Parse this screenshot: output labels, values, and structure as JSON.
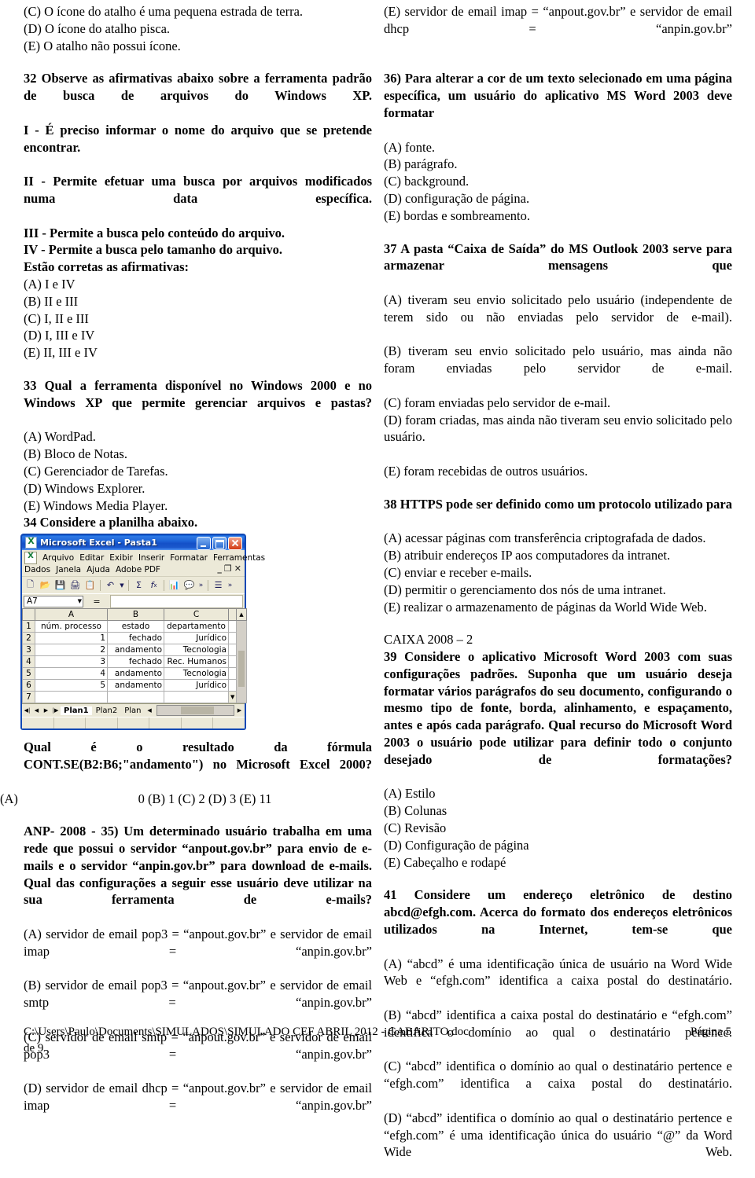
{
  "document": {
    "footer_path": "C:\\Users\\Paulo\\Documents\\SIMULADOS\\SIMULADO CEF ABRIL 2012 - GABARITO.doc",
    "footer_page": "Página 5",
    "footer_page_cont": "de 9"
  },
  "left_column": {
    "q31_tail_options": [
      "(C) O ícone do atalho é uma pequena estrada de terra.",
      "(D) O ícone do atalho pisca.",
      "(E) O atalho não possui ícone."
    ],
    "q32": {
      "stem": "32 Observe as afirmativas abaixo sobre a ferramenta padrão de busca de arquivos do Windows XP.",
      "statements": [
        "I - É preciso informar o nome do arquivo que se pretende encontrar.",
        "II - Permite efetuar uma busca por arquivos modificados numa data específica.",
        "III - Permite a busca pelo conteúdo do arquivo.",
        "IV - Permite a busca pelo tamanho do arquivo.",
        "Estão corretas as afirmativas:"
      ],
      "options": [
        "(A) I e IV",
        "(B) II e III",
        "(C) I, II e III",
        "(D) I, III e IV",
        "(E) II, III e IV"
      ]
    },
    "q33": {
      "stem": "33 Qual a ferramenta disponível no Windows 2000 e no Windows XP que permite gerenciar arquivos e pastas?",
      "options": [
        "(A) WordPad.",
        "(B) Bloco de Notas.",
        "(C) Gerenciador de Tarefas.",
        "(D) Windows Explorer.",
        "(E) Windows Media Player."
      ]
    },
    "q34": {
      "stem": "34 Considere a planilha abaixo.",
      "question": "Qual é o resultado da fórmula CONT.SE(B2:B6;\"andamento\") no Microsoft Excel 2000?",
      "answer_label": "(A)",
      "answer_options": "0 (B) 1 (C) 2 (D) 3 (E) 11"
    },
    "q35": {
      "stem": "ANP- 2008 - 35) Um determinado usuário trabalha em uma rede que possui o servidor “anpout.gov.br” para envio de e-mails e o servidor “anpin.gov.br” para download de e-mails. Qual das configurações a seguir esse usuário deve utilizar na sua ferramenta de e-mails?",
      "options": [
        "(A) servidor de email pop3 = “anpout.gov.br” e servidor de email imap = “anpin.gov.br”",
        "(B) servidor de email pop3 = “anpout.gov.br” e servidor de email smtp = “anpin.gov.br”",
        "(C) servidor de email smtp = “anpout.gov.br” e servidor de email pop3 = “anpin.gov.br”",
        "(D) servidor de email dhcp = “anpout.gov.br” e servidor de email imap = “anpin.gov.br”"
      ]
    }
  },
  "right_column": {
    "q35_tail": "(E) servidor de email imap = “anpout.gov.br” e servidor de email dhcp = “anpin.gov.br”",
    "q36": {
      "stem": "36) Para alterar a cor de um texto selecionado em uma página específica, um usuário do aplicativo MS Word 2003 deve formatar",
      "options": [
        "(A) fonte.",
        "(B) parágrafo.",
        "(C) background.",
        "(D) configuração de página.",
        "(E) bordas e sombreamento."
      ]
    },
    "q37": {
      "stem": "37 A pasta “Caixa de Saída” do MS Outlook 2003 serve para armazenar mensagens que",
      "options": [
        "(A) tiveram seu envio solicitado pelo usuário (independente de terem sido ou não enviadas pelo servidor de e-mail).",
        "(B) tiveram seu envio solicitado pelo usuário, mas ainda não foram enviadas pelo servidor de e-mail.",
        "(C) foram enviadas pelo servidor de e-mail.",
        "(D) foram criadas, mas ainda não tiveram seu envio solicitado pelo usuário.",
        "(E) foram recebidas de outros usuários."
      ]
    },
    "q38": {
      "stem": "38 HTTPS pode ser definido como um protocolo utilizado para",
      "options": [
        "(A) acessar páginas com transferência criptografada de dados.",
        "(B) atribuir endereços IP aos computadores da intranet.",
        "(C) enviar e receber e-mails.",
        "(D) permitir o gerenciamento dos nós de uma intranet.",
        "(E) realizar o armazenamento de páginas da World Wide Web."
      ]
    },
    "section_label": "CAIXA 2008 – 2",
    "q39": {
      "stem": "39 Considere o aplicativo Microsoft Word 2003 com suas configurações padrões. Suponha que um usuário deseja formatar vários parágrafos do seu documento, configurando o mesmo tipo de fonte, borda, alinhamento, e espaçamento, antes e após cada parágrafo. Qual recurso do Microsoft Word 2003 o usuário pode utilizar para definir todo o conjunto desejado de formatações?",
      "options": [
        "(A) Estilo",
        "(B) Colunas",
        "(C) Revisão",
        "(D) Configuração de página",
        "(E) Cabeçalho e rodapé"
      ]
    },
    "q41": {
      "stem": "41 Considere um endereço eletrônico de destino abcd@efgh.com. Acerca do formato dos endereços eletrônicos utilizados na Internet, tem-se que",
      "options": [
        "(A) “abcd” é uma identificação única de usuário na Word Wide Web e “efgh.com” identifica a caixa postal do destinatário.",
        "(B) “abcd” identifica a caixa postal do destinatário e “efgh.com” identifica o domínio ao qual o destinatário pertence.",
        "(C) “abcd” identifica o domínio ao qual o destinatário pertence e “efgh.com” identifica a caixa postal do destinatário.",
        "(D) “abcd” identifica o domínio ao qual o destinatário pertence e “efgh.com” é uma identificação única do usuário “@” da Word Wide Web."
      ]
    }
  },
  "excel_window": {
    "title": "Microsoft Excel - Pasta1",
    "window_buttons": [
      "minimize",
      "maximize",
      "close"
    ],
    "menus_row1": [
      "Arquivo",
      "Editar",
      "Exibir",
      "Inserir",
      "Formatar",
      "Ferramentas"
    ],
    "menus_row2": [
      "Dados",
      "Janela",
      "Ajuda",
      "Adobe PDF"
    ],
    "doc_buttons": [
      "_",
      "restore",
      "X"
    ],
    "toolbar_icons": [
      "new-doc",
      "open-folder",
      "save-disk",
      "print",
      "print-preview",
      "undo",
      "undo-dropdown",
      "autosum",
      "function",
      "chart",
      "help",
      "more",
      "align",
      "more2"
    ],
    "name_box": "A7",
    "formula_prefix": "=",
    "formula_value": "",
    "columns": [
      "A",
      "B",
      "C"
    ],
    "rows": [
      {
        "n": "1",
        "a": "núm. processo",
        "b": "estado",
        "c": "departamento"
      },
      {
        "n": "2",
        "a": "1",
        "b": "fechado",
        "c": "Jurídico"
      },
      {
        "n": "3",
        "a": "2",
        "b": "andamento",
        "c": "Tecnologia"
      },
      {
        "n": "4",
        "a": "3",
        "b": "fechado",
        "c": "Rec. Humanos"
      },
      {
        "n": "5",
        "a": "4",
        "b": "andamento",
        "c": "Tecnologia"
      },
      {
        "n": "6",
        "a": "5",
        "b": "andamento",
        "c": "Jurídico"
      },
      {
        "n": "7",
        "a": "",
        "b": "",
        "c": ""
      }
    ],
    "sheet_tabs": [
      "Plan1",
      "Plan2",
      "Plan"
    ],
    "active_tab": "Plan1"
  }
}
